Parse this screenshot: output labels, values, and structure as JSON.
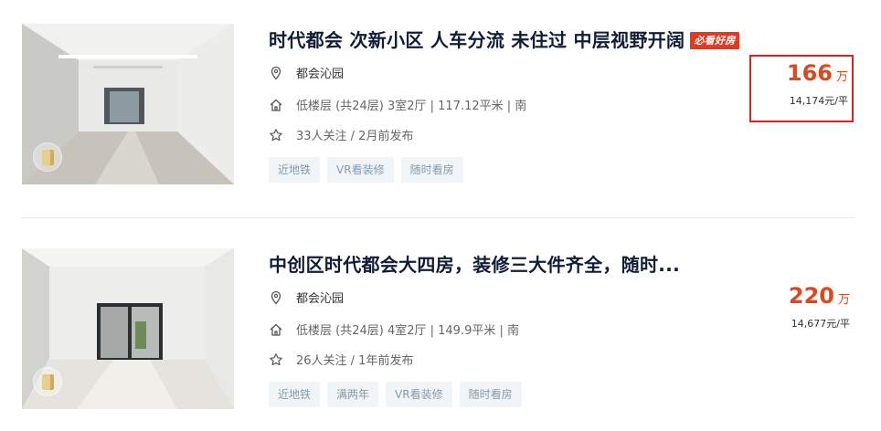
{
  "listings": [
    {
      "title": "时代都会 次新小区 人车分流 未住过 中层视野开阔",
      "badge": "必看好房",
      "community": "都会沁园",
      "info": "低楼层 (共24层) 3室2厅 | 117.12平米 | 南",
      "follow": "33人关注 / 2月前发布",
      "tags": [
        "近地铁",
        "VR看装修",
        "随时看房"
      ],
      "price": "166",
      "price_unit": "万",
      "unit_price": "14,174元/平"
    },
    {
      "title": "中创区时代都会大四房，装修三大件齐全，随时...",
      "badge": "",
      "community": "都会沁园",
      "info": "低楼层 (共24层) 4室2厅 | 149.9平米 | 南",
      "follow": "26人关注 / 1年前发布",
      "tags": [
        "近地铁",
        "满两年",
        "VR看装修",
        "随时看房"
      ],
      "price": "220",
      "price_unit": "万",
      "unit_price": "14,677元/平"
    }
  ],
  "icons": {
    "location": "location-pin-icon",
    "house": "house-icon",
    "star": "star-icon",
    "vr": "vr-icon"
  },
  "colors": {
    "price": "#e0471f",
    "badge": "#e5381f",
    "highlight_border": "#e01f1f",
    "tag_text": "#849aae",
    "tag_bg": "#f2f5f7",
    "title": "#101d37"
  }
}
